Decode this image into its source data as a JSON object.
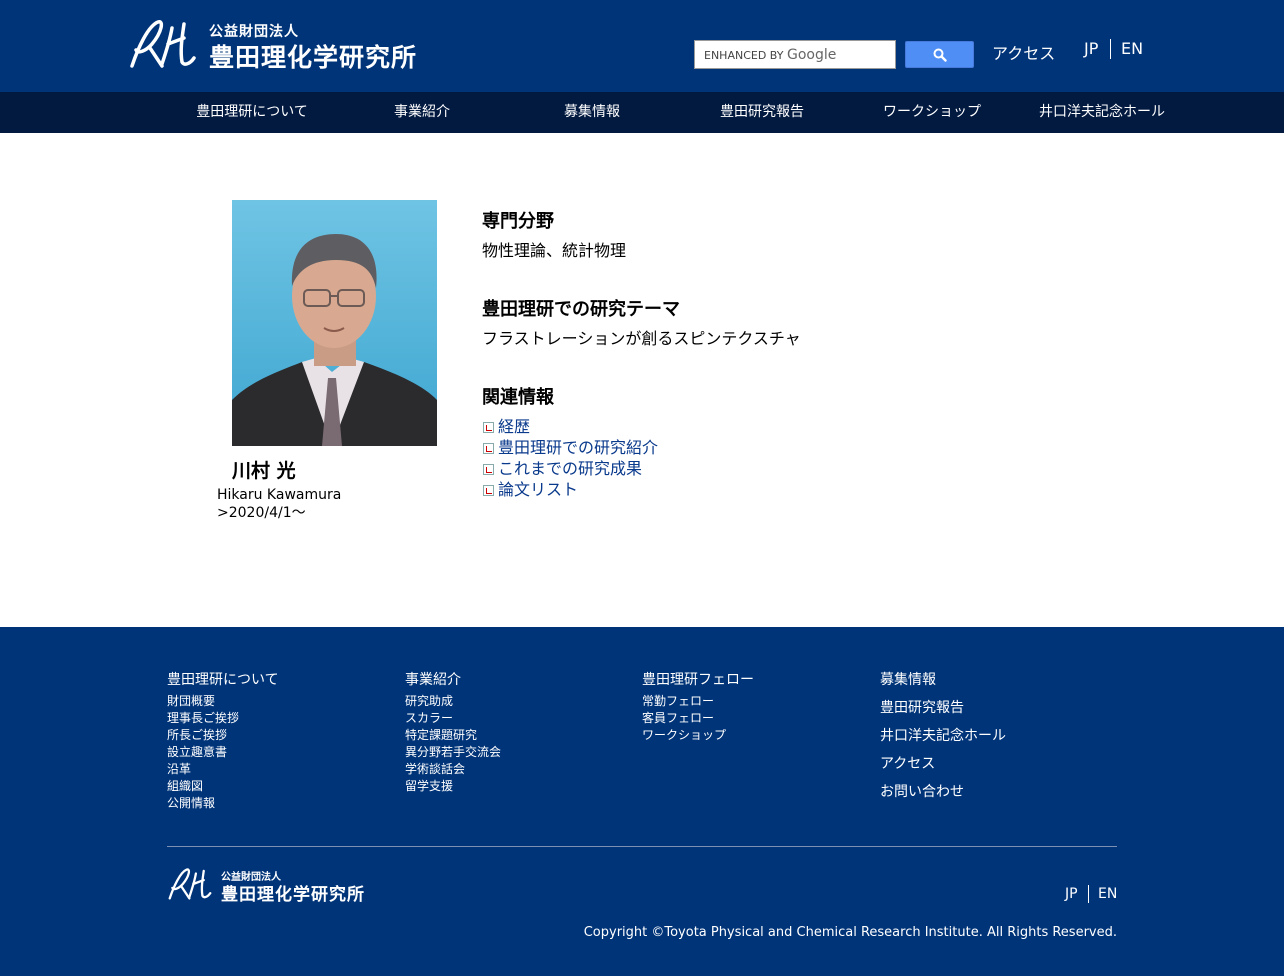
{
  "header": {
    "logo_small": "公益財団法人",
    "logo_big": "豊田理化学研究所",
    "search_placeholder_prefix": "ENHANCED BY",
    "search_placeholder_brand": "Google",
    "access": "アクセス",
    "lang_jp": "JP",
    "lang_en": "EN"
  },
  "nav": {
    "items": [
      "豊田理研について",
      "事業紹介",
      "募集情報",
      "豊田研究報告",
      "ワークショップ",
      "井口洋夫記念ホール"
    ]
  },
  "profile": {
    "name": "川村 光",
    "name_en": "Hikaru Kawamura",
    "period": ">2020/4/1～"
  },
  "content": {
    "field_heading": "専門分野",
    "field_text": "物性理論、統計物理",
    "theme_heading": "豊田理研での研究テーマ",
    "theme_text": "フラストレーションが創るスピンテクスチャ",
    "related_heading": "関連情報",
    "links": [
      "経歴",
      "豊田理研での研究紹介",
      "これまでの研究成果",
      "論文リスト"
    ]
  },
  "footer": {
    "col1": {
      "head": "豊田理研について",
      "items": [
        "財団概要",
        "理事長ご挨拶",
        "所長ご挨拶",
        "設立趣意書",
        "沿革",
        "組織図",
        "公開情報"
      ]
    },
    "col2": {
      "head": "事業紹介",
      "items": [
        "研究助成",
        "スカラー",
        "特定課題研究",
        "異分野若手交流会",
        "学術談話会",
        "留学支援"
      ]
    },
    "col3": {
      "head": "豊田理研フェロー",
      "items": [
        "常勤フェロー",
        "客員フェロー",
        "ワークショップ"
      ]
    },
    "col4": {
      "items": [
        "募集情報",
        "豊田研究報告",
        "井口洋夫記念ホール",
        "アクセス",
        "お問い合わせ"
      ]
    },
    "logo_small": "公益財団法人",
    "logo_big": "豊田理化学研究所",
    "lang_jp": "JP",
    "lang_en": "EN",
    "copyright": "Copyright ©Toyota Physical and Chemical Research Institute. All Rights Reserved."
  },
  "colors": {
    "header_bg": "#003479",
    "nav_bg": "#021940",
    "link": "#0a3a8c",
    "search_button": "#4f8ef5"
  }
}
